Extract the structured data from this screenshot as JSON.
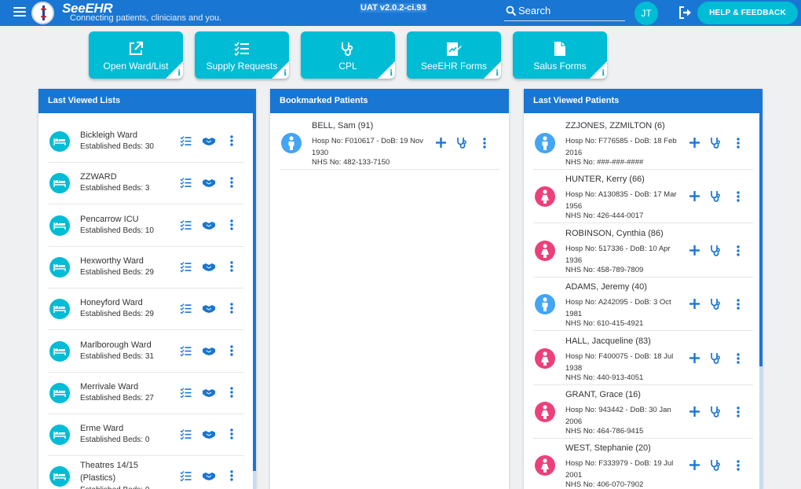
{
  "header": {
    "brand": "SeeEHR",
    "tagline": "Connecting patients, clinicians and you.",
    "environment": "UAT v2.0.2-ci.93",
    "search_label": "Search",
    "user_initials": "JT",
    "help_label": "HELP & FEEDBACK"
  },
  "tiles": [
    {
      "label": "Open Ward/List",
      "icon": "external-link-icon"
    },
    {
      "label": "Supply Requests",
      "icon": "checklist-icon"
    },
    {
      "label": "CPL",
      "icon": "stethoscope-icon"
    },
    {
      "label": "SeeEHR Forms",
      "icon": "edit-form-icon"
    },
    {
      "label": "Salus Forms",
      "icon": "document-icon"
    }
  ],
  "tile_info_glyph": "i",
  "panels": {
    "last_viewed_lists": {
      "title": "Last Viewed Lists",
      "items": [
        {
          "name": "Bickleigh Ward",
          "beds": "Established Beds: 30"
        },
        {
          "name": "ZZWARD",
          "beds": "Established Beds: 3"
        },
        {
          "name": "Pencarrow ICU",
          "beds": "Established Beds: 10"
        },
        {
          "name": "Hexworthy Ward",
          "beds": "Established Beds: 29"
        },
        {
          "name": "Honeyford Ward",
          "beds": "Established Beds: 29"
        },
        {
          "name": "Marlborough Ward",
          "beds": "Established Beds: 31"
        },
        {
          "name": "Merrivale Ward",
          "beds": "Established Beds: 27"
        },
        {
          "name": "Erme Ward",
          "beds": "Established Beds: 0"
        },
        {
          "name": "Theatres 14/15 (Plastics)",
          "beds": "Established Beds: 0"
        }
      ]
    },
    "bookmarked_patients": {
      "title": "Bookmarked Patients",
      "items": [
        {
          "name": "BELL, Sam (91)",
          "hosp": "Hosp No: F010617 - DoB: 19 Nov 1930",
          "nhs": "NHS No: 482-133-7150",
          "sex": "male"
        }
      ]
    },
    "last_viewed_patients": {
      "title": "Last Viewed Patients",
      "items": [
        {
          "name": "ZZJONES, ZZMILTON (6)",
          "hosp": "Hosp No: F776585 - DoB: 18 Feb 2016",
          "nhs": "NHS No: ###-###-####",
          "sex": "male"
        },
        {
          "name": "HUNTER, Kerry (66)",
          "hosp": "Hosp No: A130835 - DoB: 17 Mar 1956",
          "nhs": "NHS No: 426-444-0017",
          "sex": "female"
        },
        {
          "name": "ROBINSON, Cynthia (86)",
          "hosp": "Hosp No: 517336 - DoB: 10 Apr 1936",
          "nhs": "NHS No: 458-789-7809",
          "sex": "female"
        },
        {
          "name": "ADAMS, Jeremy (40)",
          "hosp": "Hosp No: A242095 - DoB: 3 Oct 1981",
          "nhs": "NHS No: 610-415-4921",
          "sex": "male"
        },
        {
          "name": "HALL, Jacqueline (83)",
          "hosp": "Hosp No: F400075 - DoB: 18 Jul 1938",
          "nhs": "NHS No: 440-913-4051",
          "sex": "female"
        },
        {
          "name": "GRANT, Grace (16)",
          "hosp": "Hosp No: 943442 - DoB: 30 Jan 2006",
          "nhs": "NHS No: 464-786-9415",
          "sex": "female"
        },
        {
          "name": "WEST, Stephanie (20)",
          "hosp": "Hosp No: F333979 - DoB: 19 Jul 2001",
          "nhs": "NHS No: 406-070-7902",
          "sex": "female"
        }
      ]
    }
  },
  "colors": {
    "primary": "#1976d2",
    "accent": "#00bcd4",
    "male": "#42a5f5",
    "female": "#ec407a"
  }
}
